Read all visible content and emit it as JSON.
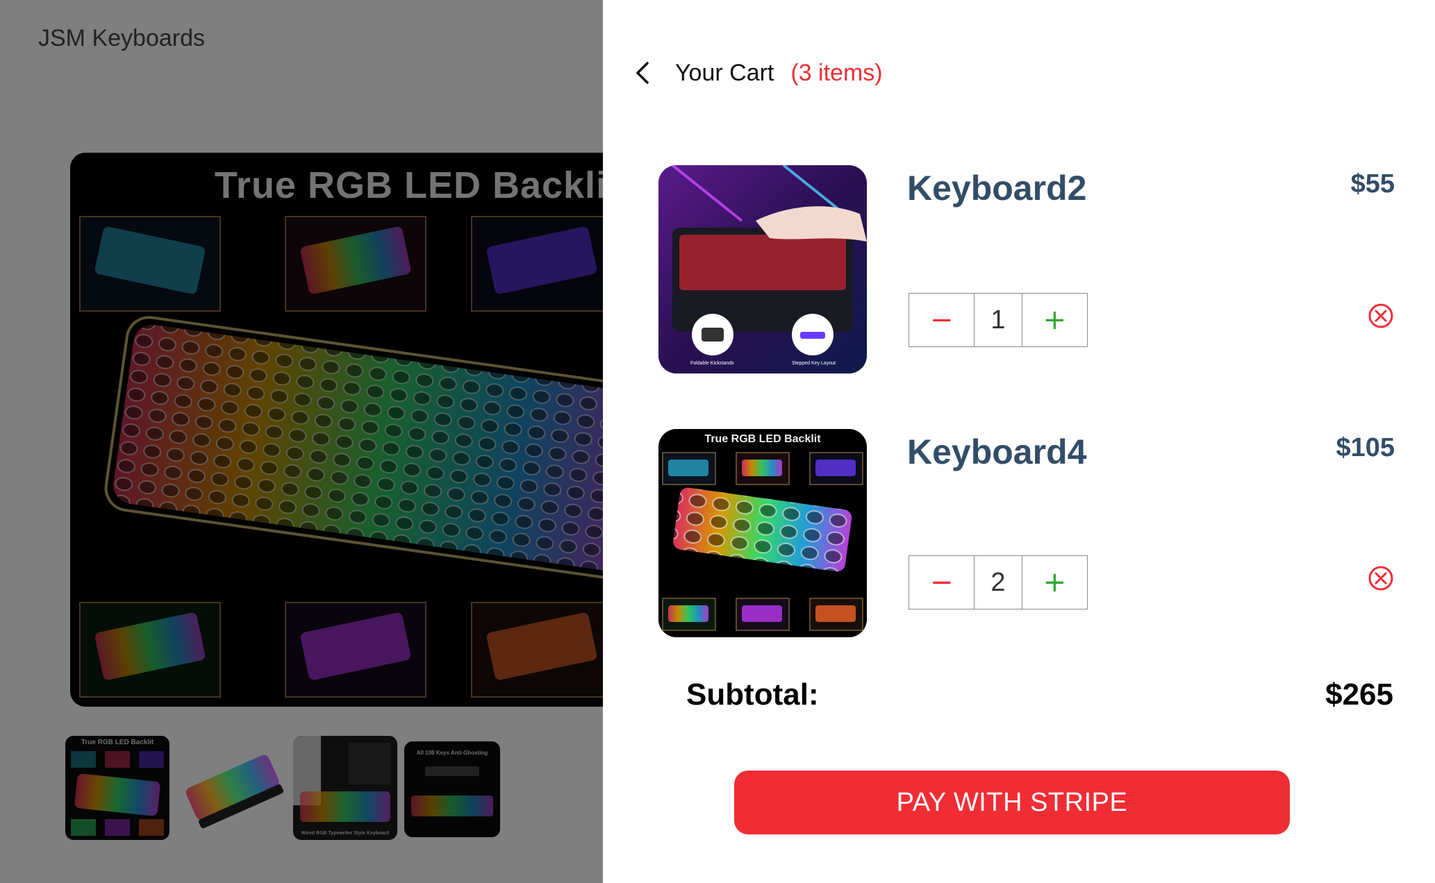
{
  "app": {
    "brand": "JSM Keyboards"
  },
  "product_page": {
    "hero_image": {
      "title": "True RGB LED Backlit",
      "icon": "rgb-keyboard-image"
    },
    "thumbnails": [
      {
        "icon": "rgb-keyboard-thumbnail",
        "title": "True RGB LED Backlit",
        "caption": ""
      },
      {
        "icon": "keyboard-side-thumbnail",
        "title": "",
        "caption": ""
      },
      {
        "icon": "keyboard-desk-thumbnail",
        "title": "",
        "caption": "Wired RGB Typewriter Style Keyboard"
      },
      {
        "icon": "keyboard-antighost-thumbnail",
        "title": "All 108 Keys Anti-Ghosting",
        "caption": ""
      }
    ]
  },
  "cart": {
    "title": "Your Cart",
    "count_label": "(3 items)",
    "items": [
      {
        "name": "Keyboard2",
        "price": "$55",
        "quantity": "1",
        "image_captions": [
          "Foldable Kickstands",
          "Stepped Key Layout"
        ]
      },
      {
        "name": "Keyboard4",
        "price": "$105",
        "quantity": "2",
        "image_title": "True RGB LED Backlit"
      }
    ],
    "subtotal_label": "Subtotal:",
    "subtotal_value": "$265",
    "pay_button": "PAY WITH STRIPE",
    "qty_minus": "−",
    "qty_plus": "+"
  },
  "colors": {
    "accent": "#f02d34",
    "product_name": "#324d67",
    "plus_green": "#31a831",
    "overlay": "rgba(0,0,0,0.5)"
  }
}
